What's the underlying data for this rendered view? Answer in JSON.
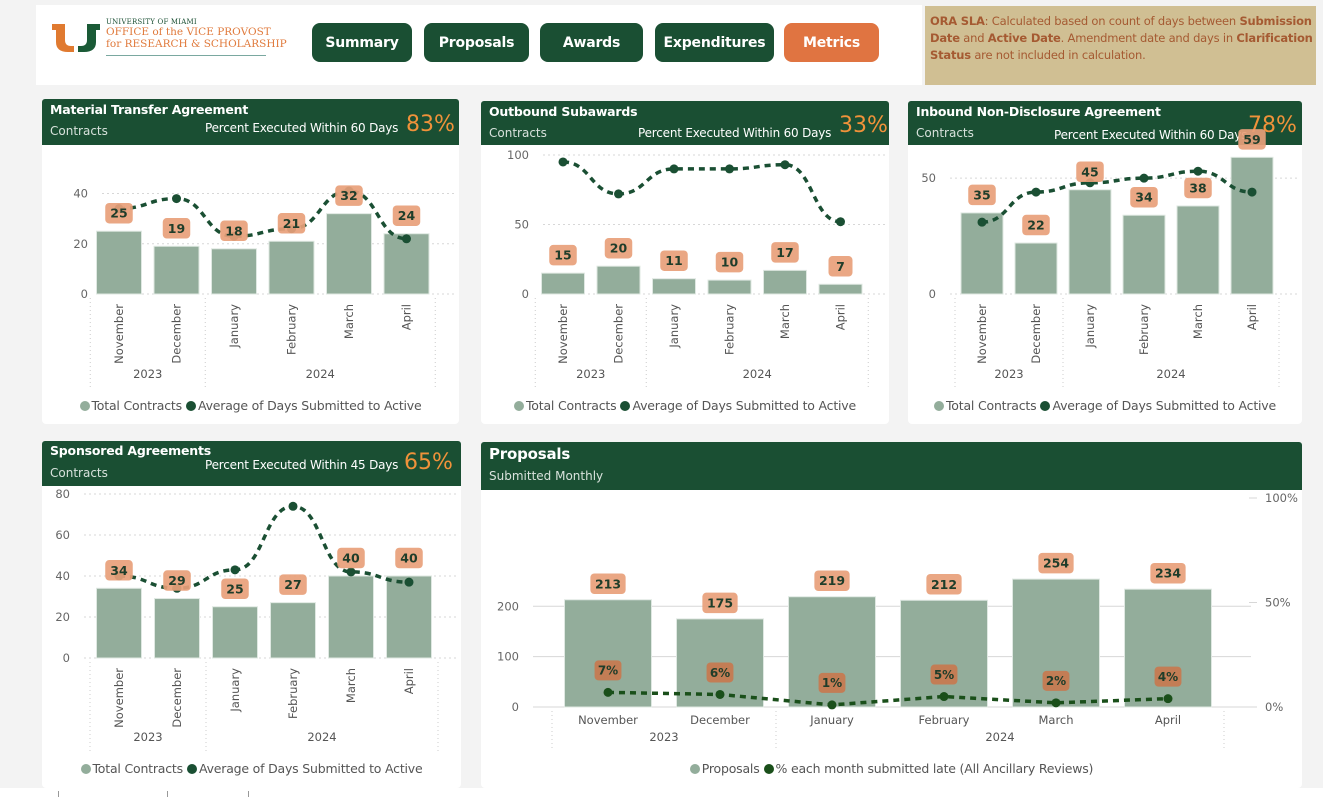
{
  "header": {
    "logo": {
      "university": "UNIVERSITY OF MIAMI",
      "line1": "OFFICE of the VICE PROVOST",
      "line2": "for RESEARCH & SCHOLARSHIP",
      "icon": "u-logo-icon"
    },
    "nav": [
      {
        "label": "Summary",
        "active": false
      },
      {
        "label": "Proposals",
        "active": false
      },
      {
        "label": "Awards",
        "active": false
      },
      {
        "label": "Expenditures",
        "active": false
      },
      {
        "label": "Metrics",
        "active": true
      }
    ],
    "sla_note": {
      "parts": [
        {
          "text": "ORA SLA",
          "bold": true
        },
        {
          "text": ": Calculated based on count of days between ",
          "bold": false
        },
        {
          "text": "Submission Date",
          "bold": true
        },
        {
          "text": " and ",
          "bold": false
        },
        {
          "text": "Active Date",
          "bold": true
        },
        {
          "text": ". Amendment date and days in ",
          "bold": false
        },
        {
          "text": "Clarification Status",
          "bold": true
        },
        {
          "text": " are not included in calculation.",
          "bold": false
        }
      ]
    }
  },
  "colors": {
    "brand_green": "#1a4f33",
    "brand_orange": "#e07441",
    "bar": "#93ad9b",
    "line": "#1a4f33",
    "label_bg": "#e8a07a",
    "pct_accent": "#f0923a",
    "sla_bg": "#d0bf93",
    "sla_text": "#a55a32"
  },
  "cards": {
    "mta": {
      "title": "Material Transfer Agreement",
      "subtitle": "Contracts",
      "metric_label": "Percent Executed Within 60 Days",
      "metric_value": "83%"
    },
    "outbound": {
      "title": "Outbound Subawards",
      "subtitle": "Contracts",
      "metric_label": "Percent Executed Within 60 Days",
      "metric_value": "33%"
    },
    "inbound": {
      "title": "Inbound Non-Disclosure Agreement",
      "subtitle": "Contracts",
      "metric_label": "Percent Executed Within 60 Days",
      "metric_value": "78%"
    },
    "sponsored": {
      "title": "Sponsored Agreements",
      "subtitle": "Contracts",
      "metric_label": "Percent Executed Within 45 Days",
      "metric_value": "65%"
    },
    "proposals": {
      "title": "Proposals",
      "subtitle": "Submitted Monthly"
    }
  },
  "chart_data": [
    {
      "id": "mta",
      "type": "bar",
      "title": "Material Transfer Agreement",
      "categories": [
        "November",
        "December",
        "January",
        "February",
        "March",
        "April"
      ],
      "year_groups": [
        {
          "label": "2023",
          "span": 2
        },
        {
          "label": "2024",
          "span": 4
        }
      ],
      "series": [
        {
          "name": "Total Contracts",
          "kind": "bar",
          "values": [
            25,
            19,
            18,
            21,
            32,
            24
          ]
        },
        {
          "name": "Average of Days Submitted to Active",
          "kind": "line",
          "values": [
            34,
            38,
            23,
            26,
            41,
            22
          ]
        }
      ],
      "yticks": [
        0,
        20,
        40
      ],
      "ylim": [
        0,
        45
      ],
      "legend": "bottom",
      "grid": true
    },
    {
      "id": "outbound",
      "type": "bar",
      "title": "Outbound Subawards",
      "categories": [
        "November",
        "December",
        "January",
        "February",
        "March",
        "April"
      ],
      "year_groups": [
        {
          "label": "2023",
          "span": 2
        },
        {
          "label": "2024",
          "span": 4
        }
      ],
      "series": [
        {
          "name": "Total Contracts",
          "kind": "bar",
          "values": [
            15,
            20,
            11,
            10,
            17,
            7
          ]
        },
        {
          "name": "Average of Days Submitted to Active",
          "kind": "line",
          "values": [
            95,
            72,
            90,
            90,
            93,
            52
          ]
        }
      ],
      "yticks": [
        0,
        50,
        100
      ],
      "ylim": [
        0,
        100
      ],
      "legend": "bottom",
      "grid": true
    },
    {
      "id": "inbound",
      "type": "bar",
      "title": "Inbound Non-Disclosure Agreement",
      "categories": [
        "November",
        "December",
        "January",
        "February",
        "March",
        "April"
      ],
      "year_groups": [
        {
          "label": "2023",
          "span": 2
        },
        {
          "label": "2024",
          "span": 4
        }
      ],
      "series": [
        {
          "name": "Total Contracts",
          "kind": "bar",
          "values": [
            35,
            22,
            45,
            34,
            38,
            59
          ]
        },
        {
          "name": "Average of Days Submitted to Active",
          "kind": "line",
          "values": [
            31,
            44,
            48,
            50,
            53,
            44
          ]
        }
      ],
      "yticks": [
        0,
        50
      ],
      "ylim": [
        0,
        60
      ],
      "legend": "bottom",
      "grid": true
    },
    {
      "id": "sponsored",
      "type": "bar",
      "title": "Sponsored Agreements",
      "categories": [
        "November",
        "December",
        "January",
        "February",
        "March",
        "April"
      ],
      "year_groups": [
        {
          "label": "2023",
          "span": 2
        },
        {
          "label": "2024",
          "span": 4
        }
      ],
      "series": [
        {
          "name": "Total Contracts",
          "kind": "bar",
          "values": [
            34,
            29,
            25,
            27,
            40,
            40
          ]
        },
        {
          "name": "Average of Days Submitted to Active",
          "kind": "line",
          "values": [
            40,
            34,
            43,
            74,
            42,
            37
          ]
        }
      ],
      "yticks": [
        0,
        20,
        40,
        60,
        80
      ],
      "ylim": [
        0,
        80
      ],
      "legend": "bottom",
      "grid": true
    },
    {
      "id": "proposals",
      "type": "bar",
      "title": "Proposals",
      "subtitle": "Submitted Monthly",
      "categories": [
        "November",
        "December",
        "January",
        "February",
        "March",
        "April"
      ],
      "year_groups": [
        {
          "label": "2023",
          "span": 2
        },
        {
          "label": "2024",
          "span": 4
        }
      ],
      "series": [
        {
          "name": "Proposals",
          "kind": "bar",
          "axis": "left",
          "values": [
            213,
            175,
            219,
            212,
            254,
            234
          ]
        },
        {
          "name": "% each month submitted late (All Ancillary Reviews)",
          "kind": "line",
          "axis": "right",
          "values": [
            7,
            6,
            1,
            5,
            2,
            4
          ],
          "unit": "%"
        }
      ],
      "yticks": [
        0,
        100,
        200
      ],
      "ylim": [
        0,
        288
      ],
      "y2ticks": [
        "0%",
        "50%",
        "100%"
      ],
      "y2lim": [
        0,
        100
      ],
      "legend": "bottom",
      "grid": true
    }
  ]
}
